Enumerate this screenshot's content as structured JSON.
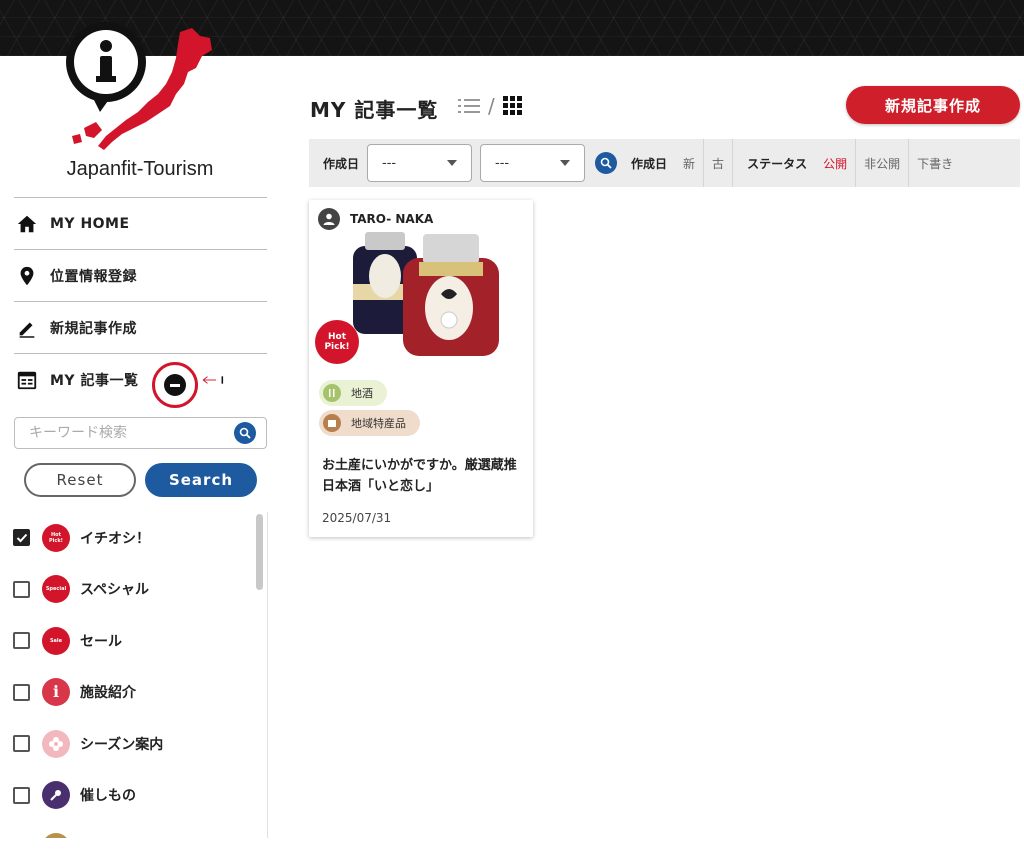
{
  "brand": {
    "name": "Japanfit-Tourism"
  },
  "nav": {
    "items": [
      {
        "label": "MY HOME",
        "icon": "home-icon"
      },
      {
        "label": "位置情報登録",
        "icon": "location-pin-icon"
      },
      {
        "label": "新規記事作成",
        "icon": "pencil-icon"
      },
      {
        "label": "MY 記事一覧",
        "icon": "calendar-list-icon"
      }
    ]
  },
  "sidebar": {
    "search_placeholder": "キーワード検索",
    "reset_label": "Reset",
    "search_label": "Search",
    "categories": [
      {
        "label": "イチオシ！",
        "checked": true,
        "badge_text": "Hot Pick!",
        "color": "#d2152b"
      },
      {
        "label": "スペシャル",
        "checked": false,
        "badge_text": "Special",
        "color": "#d2152b"
      },
      {
        "label": "セール",
        "checked": false,
        "badge_text": "Sale",
        "color": "#d2152b"
      },
      {
        "label": "施設紹介",
        "checked": false,
        "badge_text": "i",
        "color": "#d8374a"
      },
      {
        "label": "シーズン案内",
        "checked": false,
        "badge_text": "",
        "color": "#f3b7c0"
      },
      {
        "label": "催しもの",
        "checked": false,
        "badge_text": "",
        "color": "#4a2f6e"
      }
    ]
  },
  "main": {
    "title": "MY 記事一覧",
    "view_separator": "/",
    "new_button_label": "新規記事作成",
    "filter": {
      "date_label": "作成日",
      "select1_value": "---",
      "select2_value": "---",
      "sort_label": "作成日",
      "sort_new": "新",
      "sort_old": "古",
      "status_label": "ステータス",
      "status_public": "公開",
      "status_private": "非公開",
      "status_draft": "下書き"
    },
    "card": {
      "author": "TARO- NAKA",
      "hot_badge": "Hot Pick!",
      "tag1": "地酒",
      "tag2": "地域特産品",
      "title": "お土産にいかがですか。厳選蔵推日本酒「いと恋し」",
      "date": "2025/07/31"
    }
  },
  "colors": {
    "accent_red": "#d2152b",
    "primary_blue": "#1e5aa0"
  }
}
